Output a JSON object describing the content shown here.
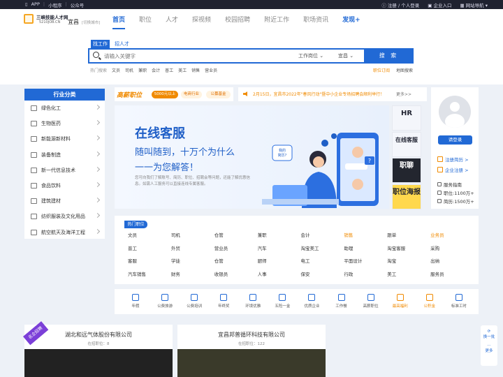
{
  "topbar": {
    "app": "APP",
    "miniprogram": "小程序",
    "official": "公众号",
    "login_register": "注册 / 个人登录",
    "company_entry": "企业入口",
    "site_nav": "网站导航"
  },
  "logo": {
    "name": "三峡技能人才网",
    "domain": "5210JOB.CN"
  },
  "city": {
    "name": "宜昌",
    "switch": "[切换城市]"
  },
  "nav": {
    "items": [
      "首页",
      "职位",
      "人才",
      "探视频",
      "校园招聘",
      "附近工作",
      "职场资讯",
      "发现+"
    ]
  },
  "search": {
    "tab_job": "找工作",
    "tab_talent": "招人才",
    "placeholder": "请输入关键字",
    "select_type": "工作岗位",
    "select_city": "宜昌",
    "button": "搜 索"
  },
  "hot_search": {
    "label": "热门搜索",
    "terms": [
      "文员",
      "司机",
      "兼职",
      "会计",
      "普工",
      "美工",
      "销售",
      "营业员"
    ],
    "subscribe": "职位订阅",
    "map_search": "地图搜索"
  },
  "categories": {
    "title": "行业分类",
    "items": [
      "绿色化工",
      "生物医药",
      "新能源新材料",
      "装备制造",
      "新一代信息技术",
      "食品饮料",
      "建筑建材",
      "纺织服装及文化用品",
      "航空航天及海洋工程"
    ]
  },
  "promo": {
    "logo": "高薪职位",
    "tag1": "5000元以上",
    "tag2": "电商行业",
    "tag3": "公募基金"
  },
  "notice": {
    "text": "2月15日，宜昌市2022年\"春风行动\"暨中小企业专场招聘会顺利举行！",
    "more": "更多>>"
  },
  "banner": {
    "title": "在线客服",
    "line1": "随叫随到，十万个为什么",
    "line2": "一一为您解答！",
    "desc": "您可向我们了解账号、简历、职位、招聘会等问题，还能了解优惠信息。如需人工服务可以直接连线专属客服。",
    "bubble": "我的简历？"
  },
  "thumbs": [
    "HR",
    "在线客服",
    "职聊",
    "职位海报"
  ],
  "user": {
    "login": "请登录",
    "register_resume": "注册简历 >",
    "company_register": "企业注册 >",
    "service": "服务指南",
    "jobs_count": "职位:1100万+",
    "resume_count": "简历:1500万+"
  },
  "hot_jobs": {
    "label": "热门职位",
    "items": [
      "文员",
      "司机",
      "仓管",
      "兼职",
      "会计",
      "销售",
      "跟单",
      "业务员",
      "普工",
      "外贸",
      "营业员",
      "汽车",
      "淘宝美工",
      "助理",
      "淘宝客服",
      "采购",
      "客服",
      "学徒",
      "仓管",
      "厨师",
      "电工",
      "平面设计",
      "淘宝",
      "出纳",
      "汽车销售",
      "财务",
      "收银员",
      "人事",
      "保安",
      "行政",
      "美工",
      "服务员"
    ],
    "highlighted": [
      "销售",
      "业务员"
    ]
  },
  "services": {
    "items": [
      "年假",
      "公费旅游",
      "公费培训",
      "年终奖",
      "环境优雅",
      "五险一金",
      "优质企业",
      "工作餐",
      "高薪职位",
      "最高福利",
      "公积金",
      "标准工时"
    ],
    "orange": [
      "最高福利",
      "公积金"
    ]
  },
  "companies": [
    {
      "name": "湖北和远气体股份有限公司",
      "jobs": "在招职位：8"
    },
    {
      "name": "宜昌邦普循环科技有限公司",
      "jobs": "在招职位：122"
    }
  ],
  "ribbon": "名企招聘",
  "side": {
    "refresh": "换一批",
    "more": "更多"
  },
  "colors": {
    "primary": "#2169d5",
    "accent": "#f08a00",
    "topbar": "#1f2230"
  }
}
